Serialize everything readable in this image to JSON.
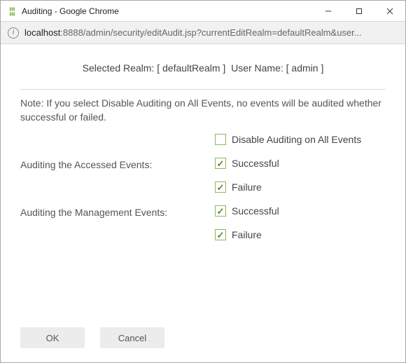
{
  "window": {
    "title": "Auditing - Google Chrome",
    "min_icon": "─",
    "max_icon": "☐",
    "close_icon": "✕"
  },
  "address": {
    "host": "localhost",
    "rest": ":8888/admin/security/editAudit.jsp?currentEditRealm=defaultRealm&user..."
  },
  "header": {
    "realm_label": "Selected Realm:",
    "realm_value": "[ defaultRealm ]",
    "username_label": "User Name:",
    "username_value": "[ admin ]"
  },
  "note_text": "Note: If you select Disable Auditing on All Events, no events will be audited whether successful or failed.",
  "options": {
    "disable_all": {
      "label": "Disable Auditing on All Events",
      "checked": false
    },
    "accessed_label": "Auditing the Accessed Events:",
    "accessed_successful": {
      "label": "Successful",
      "checked": true
    },
    "accessed_failure": {
      "label": "Failure",
      "checked": true
    },
    "management_label": "Auditing the Management Events:",
    "management_successful": {
      "label": "Successful",
      "checked": true
    },
    "management_failure": {
      "label": "Failure",
      "checked": true
    }
  },
  "buttons": {
    "ok": "OK",
    "cancel": "Cancel"
  }
}
